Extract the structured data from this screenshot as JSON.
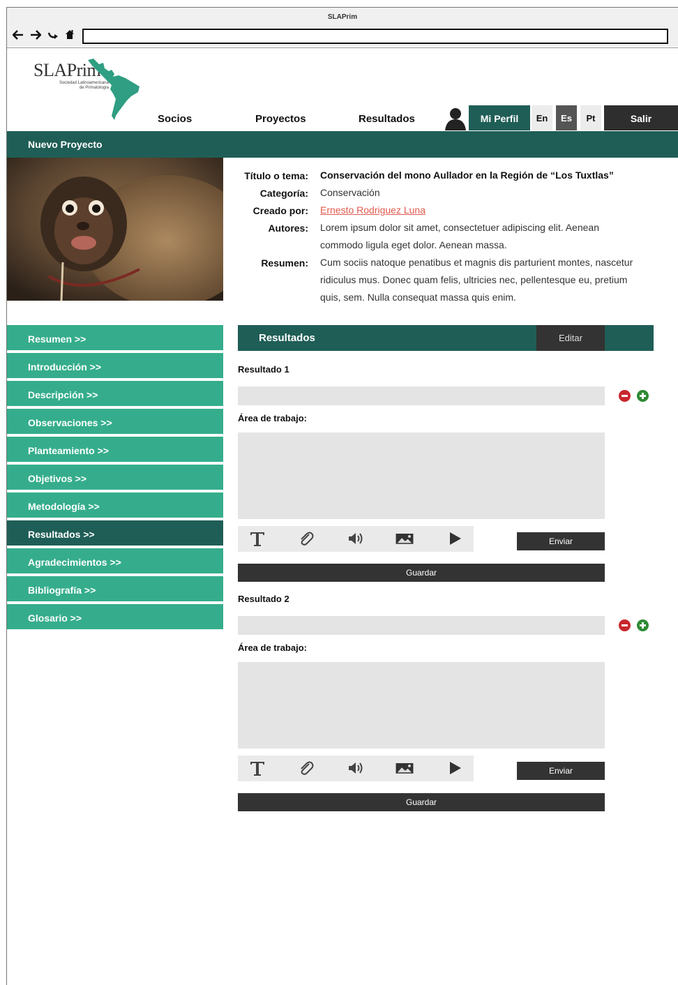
{
  "window": {
    "title": "SLAPrim"
  },
  "browser": {
    "url": ""
  },
  "logo": {
    "name": "SLAPrim",
    "subtitle_line1": "Sociedad Latinoamericana",
    "subtitle_line2": "de Primatología"
  },
  "menu": [
    "Socios",
    "Proyectos",
    "Resultados"
  ],
  "user": {
    "profile_label": "Mi Perfil",
    "logout_label": "Salir"
  },
  "languages": [
    "En",
    "Es",
    "Pt"
  ],
  "active_language": "Es",
  "section": {
    "title": "Nuevo Proyecto"
  },
  "project": {
    "labels": {
      "title": "Título o tema:",
      "category": "Categoría:",
      "created_by": "Creado por:",
      "authors": "Autores:",
      "summary": "Resumen:"
    },
    "title": "Conservación del mono Aullador en la Región de “Los Tuxtlas”",
    "category": "Conservación",
    "created_by": "Ernesto Rodriguez Luna",
    "authors": "Lorem ipsum dolor sit amet, consectetuer adipiscing elit. Aenean commodo ligula eget dolor. Aenean massa.",
    "summary": "Cum sociis natoque penatibus et magnis dis parturient montes, nascetur ridiculus mus. Donec quam felis, ultricies nec, pellentesque eu, pretium quis, sem. Nulla consequat massa quis enim."
  },
  "sidebar": {
    "items": [
      {
        "label": "Resumen >>",
        "active": false
      },
      {
        "label": "Introducción >>",
        "active": false
      },
      {
        "label": "Descripción >>",
        "active": false
      },
      {
        "label": "Observaciones >>",
        "active": false
      },
      {
        "label": "Planteamiento >>",
        "active": false
      },
      {
        "label": "Objetivos >>",
        "active": false
      },
      {
        "label": "Metodología >>",
        "active": false
      },
      {
        "label": "Resultados >>",
        "active": true
      },
      {
        "label": "Agradecimientos >>",
        "active": false
      },
      {
        "label": "Bibliografía >>",
        "active": false
      },
      {
        "label": "Glosario >>",
        "active": false
      }
    ]
  },
  "results": {
    "header": "Resultados",
    "edit_label": "Editar",
    "workspace_label": "Área de trabajo:",
    "send_label": "Enviar",
    "save_label": "Guardar",
    "blocks": [
      {
        "title": "Resultado 1",
        "value": ""
      },
      {
        "title": "Resultado 2",
        "value": ""
      }
    ]
  },
  "colors": {
    "dark_teal": "#1f5e56",
    "teal": "#35ad8c",
    "dark": "#333333",
    "link": "#e05a4e"
  }
}
